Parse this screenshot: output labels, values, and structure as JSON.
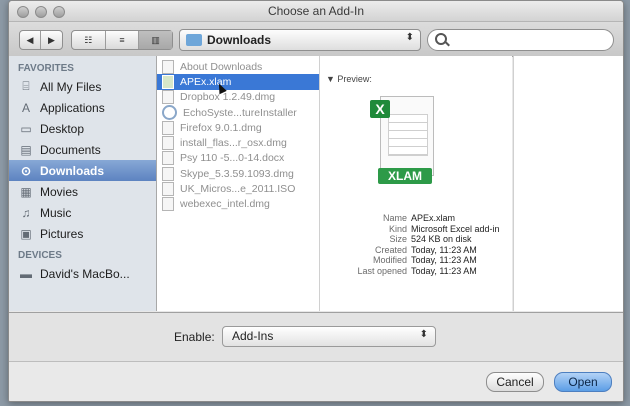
{
  "window": {
    "title": "Choose an Add-In"
  },
  "toolbar": {
    "back": "◀",
    "forward": "▶",
    "view_icons": "☷",
    "view_list": "≡",
    "view_columns": "▥",
    "location": "Downloads",
    "search_placeholder": "",
    "popup_arrows": "⬍"
  },
  "sidebar": {
    "favorites_label": "FAVORITES",
    "devices_label": "DEVICES",
    "items": [
      {
        "label": "All My Files",
        "icon": "⌸"
      },
      {
        "label": "Applications",
        "icon": "A"
      },
      {
        "label": "Desktop",
        "icon": "▭"
      },
      {
        "label": "Documents",
        "icon": "▤"
      },
      {
        "label": "Downloads",
        "icon": "⊙"
      },
      {
        "label": "Movies",
        "icon": "▦"
      },
      {
        "label": "Music",
        "icon": "♫"
      },
      {
        "label": "Pictures",
        "icon": "▣"
      }
    ],
    "devices": [
      {
        "label": "David's MacBo...",
        "icon": "▬"
      }
    ]
  },
  "files": [
    {
      "name": "About Downloads",
      "kind": "doc",
      "dim": true
    },
    {
      "name": "APEx.xlam",
      "kind": "doc",
      "selected": true
    },
    {
      "name": "Dropbox 1.2.49.dmg",
      "kind": "doc",
      "dim": true
    },
    {
      "name": "EchoSyste...tureInstaller",
      "kind": "app",
      "dim": true
    },
    {
      "name": "Firefox 9.0.1.dmg",
      "kind": "doc",
      "dim": true
    },
    {
      "name": "install_flas...r_osx.dmg",
      "kind": "doc",
      "dim": true
    },
    {
      "name": "Psy 110 -5...0-14.docx",
      "kind": "doc",
      "dim": true
    },
    {
      "name": "Skype_5.3.59.1093.dmg",
      "kind": "doc",
      "dim": true
    },
    {
      "name": "UK_Micros...e_2011.ISO",
      "kind": "doc",
      "dim": true
    },
    {
      "name": "webexec_intel.dmg",
      "kind": "doc",
      "dim": true
    }
  ],
  "preview": {
    "header": "▼ Preview:",
    "badge": "X",
    "ext": "XLAM",
    "meta": [
      {
        "k": "Name",
        "v": "APEx.xlam"
      },
      {
        "k": "Kind",
        "v": "Microsoft Excel add-in"
      },
      {
        "k": "Size",
        "v": "524 KB on disk"
      },
      {
        "k": "Created",
        "v": "Today, 11:23 AM"
      },
      {
        "k": "Modified",
        "v": "Today, 11:23 AM"
      },
      {
        "k": "Last opened",
        "v": "Today, 11:23 AM"
      }
    ]
  },
  "enable": {
    "label": "Enable:",
    "value": "Add-Ins",
    "arrows": "⬍"
  },
  "buttons": {
    "cancel": "Cancel",
    "open": "Open"
  }
}
